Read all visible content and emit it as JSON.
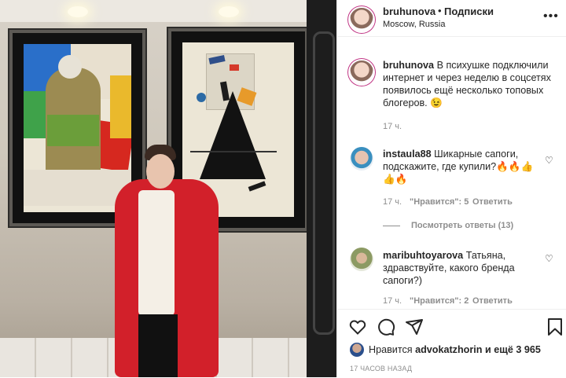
{
  "post": {
    "header": {
      "username": "bruhunova",
      "separator": "•",
      "follow_status": "Подписки",
      "location": "Moscow, Russia",
      "more_icon": "more-dots-icon"
    },
    "caption": {
      "username": "bruhunova",
      "text": "В психушке подключили интернет и через неделю в соцсетях появилось ещё несколько топовых блогеров. 😉",
      "age": "17 ч."
    },
    "comments": [
      {
        "username": "instaula88",
        "text": "Шикарные сапоги, подскажите, где купили?🔥🔥👍👍🔥",
        "age": "17 ч.",
        "likes": "\"Нравится\": 5",
        "reply": "Ответить",
        "view_replies": "Посмотреть ответы (13)"
      },
      {
        "username": "maribuhtoyarova",
        "text": "Татьяна, здравствуйте, какого бренда сапоги?)",
        "age": "17 ч.",
        "likes": "\"Нравится\": 2",
        "reply": "Ответить"
      }
    ],
    "actions": {
      "icons": [
        "heart-icon",
        "comment-icon",
        "share-icon",
        "bookmark-icon"
      ]
    },
    "likes": {
      "prefix": "Нравится",
      "user": "advokatzhorin",
      "suffix": "и ещё 3 965"
    },
    "timestamp": "17 ЧАСОВ НАЗАД",
    "colors": {
      "text": "#262626",
      "secondary": "#8e8e8e",
      "coat_red": "#d2202a",
      "border": "#efefef"
    }
  }
}
